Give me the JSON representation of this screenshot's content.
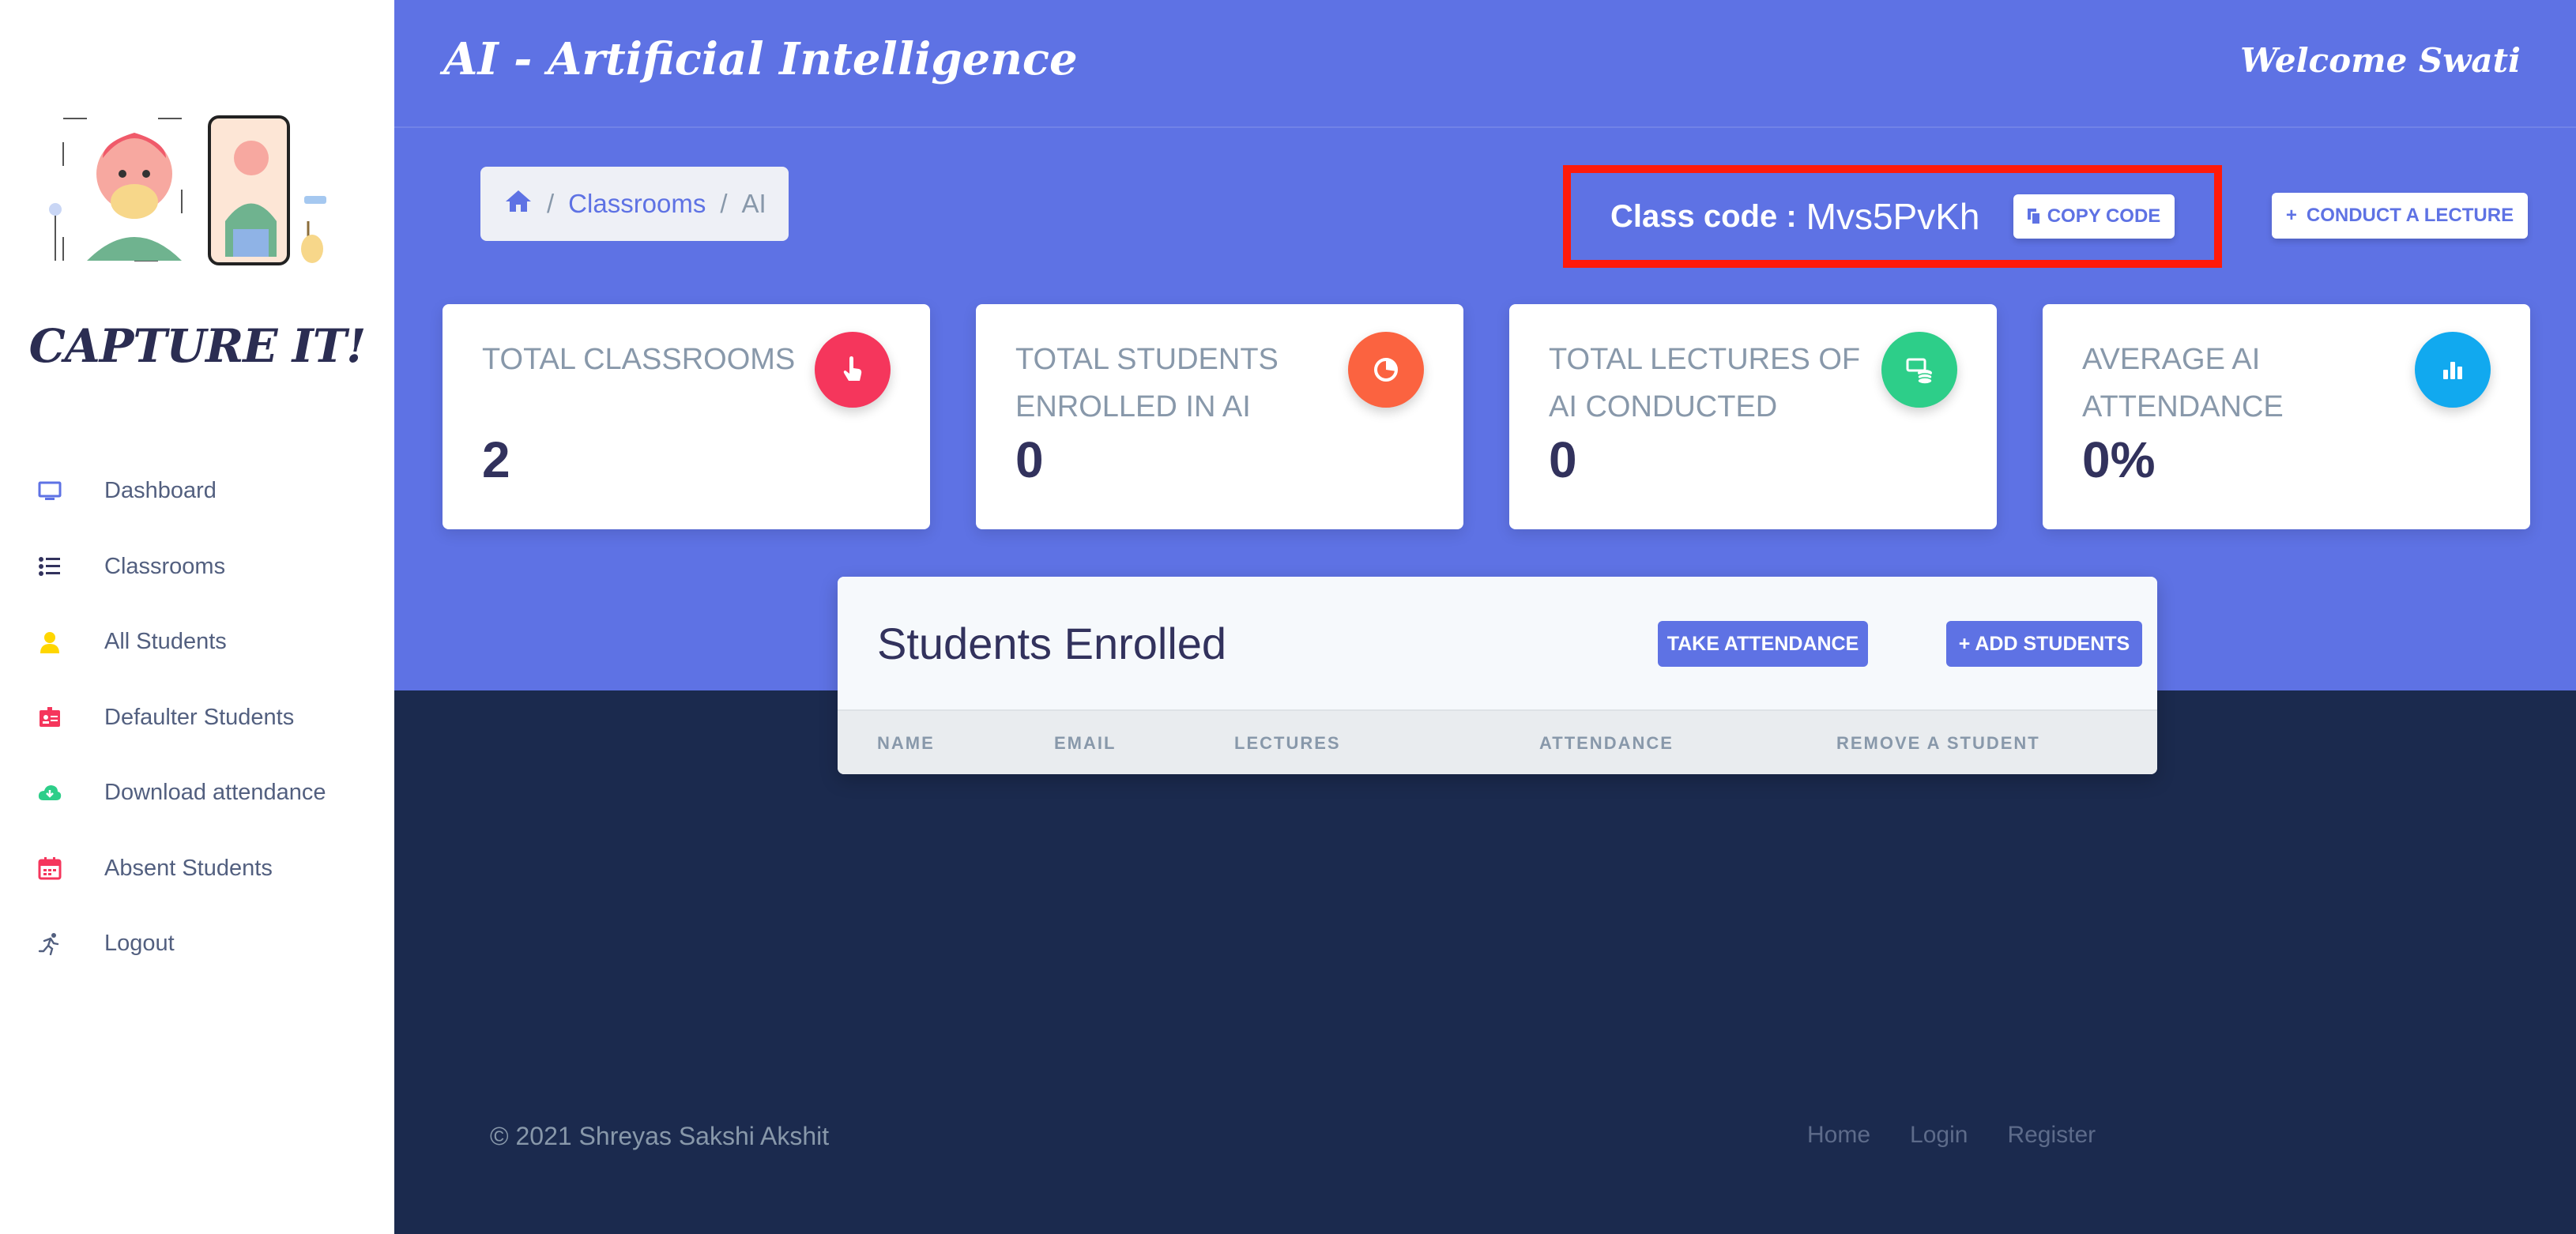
{
  "sidebar": {
    "brand": "CAPTURE IT!",
    "items": [
      {
        "label": "Dashboard",
        "icon": "monitor-icon",
        "color": "#5e72e4"
      },
      {
        "label": "Classrooms",
        "icon": "list-icon",
        "color": "#32325d"
      },
      {
        "label": "All Students",
        "icon": "user-icon",
        "color": "#ffd600"
      },
      {
        "label": "Defaulter Students",
        "icon": "id-card-icon",
        "color": "#f5365c"
      },
      {
        "label": "Download attendance",
        "icon": "cloud-download-icon",
        "color": "#2dce89"
      },
      {
        "label": "Absent Students",
        "icon": "calendar-icon",
        "color": "#f5365c"
      },
      {
        "label": "Logout",
        "icon": "running-icon",
        "color": "#525f7f"
      }
    ]
  },
  "header": {
    "title": "AI - Artificial Intelligence",
    "welcome": "Welcome Swati"
  },
  "breadcrumb": {
    "home_icon": "home-icon",
    "separator": "/",
    "items": [
      "Classrooms",
      "AI"
    ]
  },
  "class_code": {
    "label": "Class code :",
    "value": "Mvs5PvKh",
    "copy_label": "COPY CODE"
  },
  "conduct_label": "CONDUCT A LECTURE",
  "stats": [
    {
      "title": "TOTAL CLASSROOMS",
      "value": "2",
      "icon": "pointer-hand-icon",
      "color": "#f5365c"
    },
    {
      "title": "TOTAL STUDENTS ENROLLED IN AI",
      "value": "0",
      "icon": "pie-chart-icon",
      "color": "#fb6340"
    },
    {
      "title": "TOTAL LECTURES OF AI CONDUCTED",
      "value": "0",
      "icon": "money-coins-icon",
      "color": "#2dce89"
    },
    {
      "title": "AVERAGE AI ATTENDANCE",
      "value": "0%",
      "icon": "bar-chart-icon",
      "color": "#11cdef"
    }
  ],
  "enrolled": {
    "title": "Students Enrolled",
    "take_attendance": "TAKE ATTENDANCE",
    "add_students": "ADD STUDENTS",
    "columns": [
      "NAME",
      "EMAIL",
      "LECTURES",
      "ATTENDANCE",
      "REMOVE A STUDENT"
    ]
  },
  "footer": {
    "copyright": "© 2021 Shreyas Sakshi Akshit",
    "links": [
      "Home",
      "Login",
      "Register"
    ]
  }
}
